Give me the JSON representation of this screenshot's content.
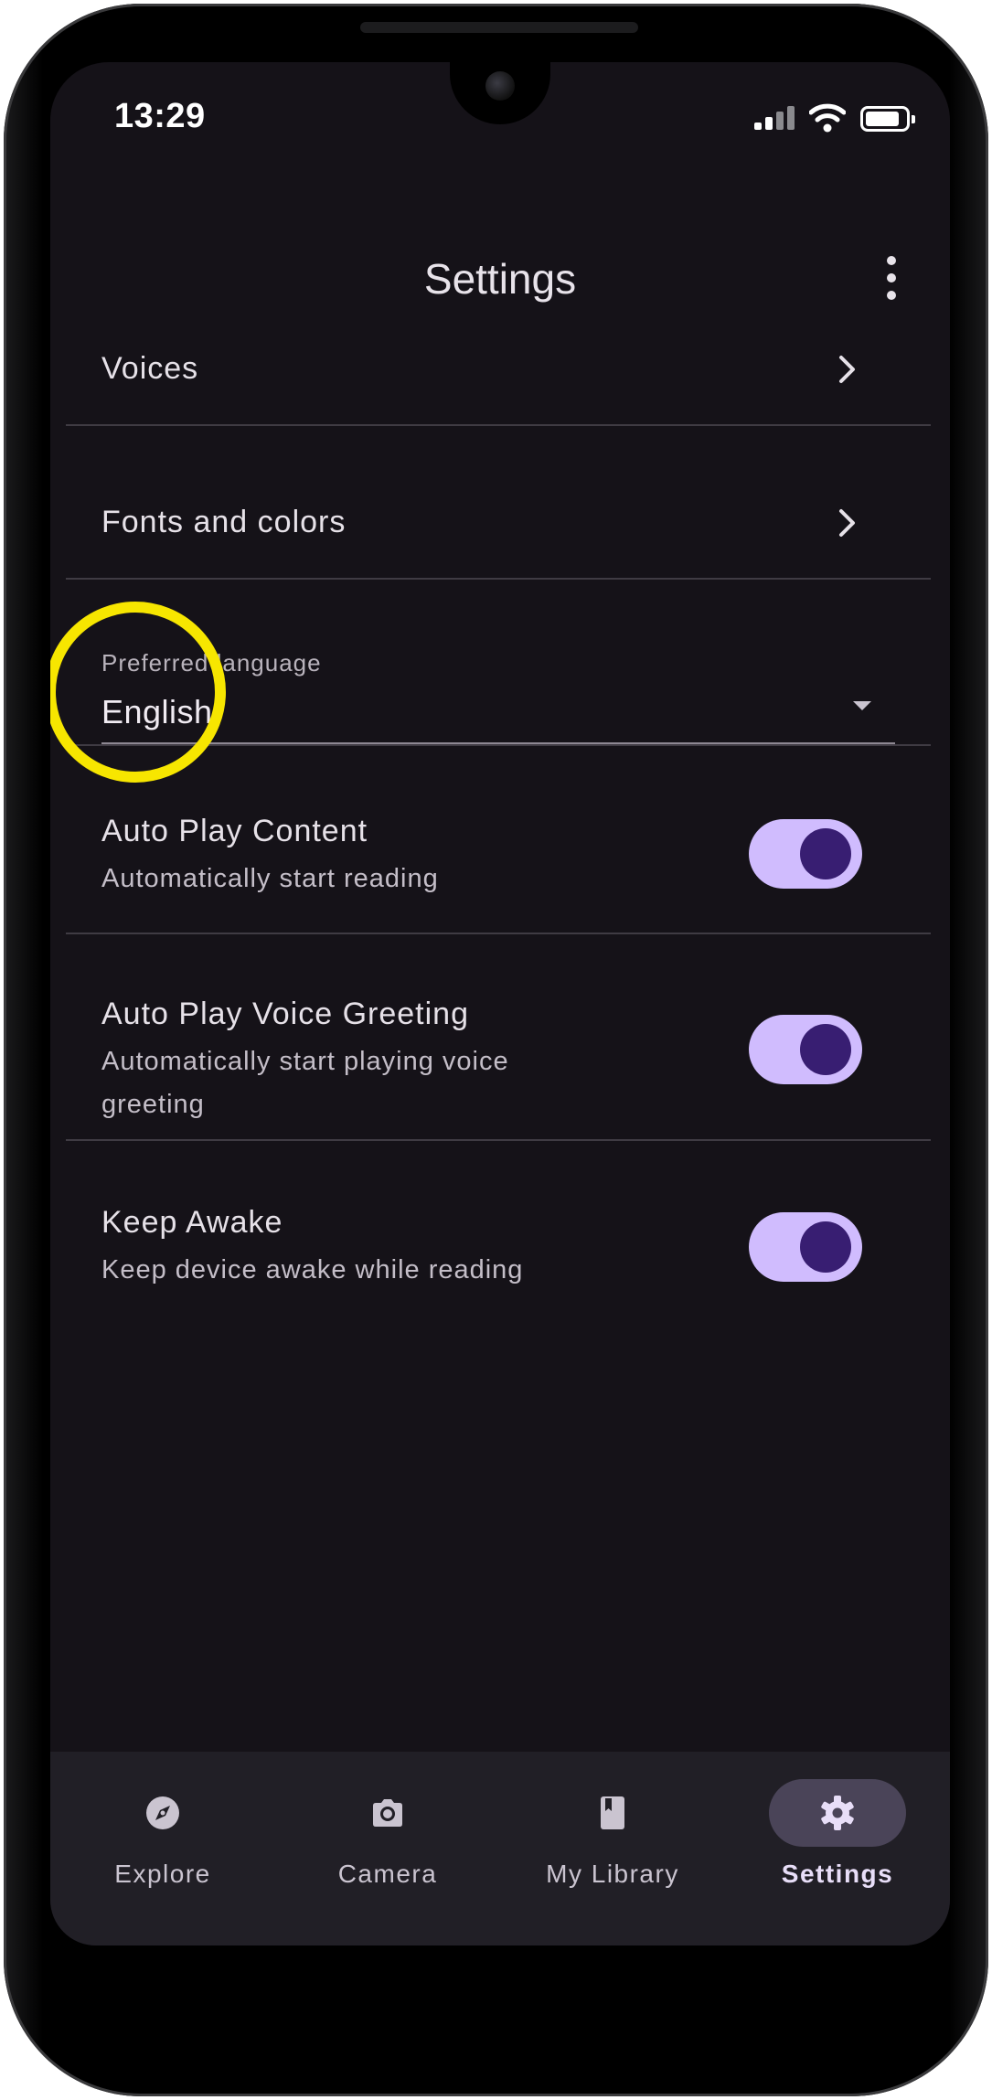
{
  "status_bar": {
    "time": "13:29"
  },
  "app_bar": {
    "title": "Settings",
    "menu_icon": "more-vert-icon"
  },
  "settings": {
    "nav_items": [
      {
        "label": "Voices",
        "icon": "chevron-right-icon"
      },
      {
        "label": "Fonts and colors",
        "icon": "chevron-right-icon"
      }
    ],
    "language": {
      "label": "Preferred language",
      "value": "English"
    },
    "toggles": [
      {
        "title": "Auto Play Content",
        "subtitle": "Automatically start reading",
        "on": true
      },
      {
        "title": "Auto Play Voice Greeting",
        "subtitle": "Automatically start playing voice greeting",
        "on": true
      },
      {
        "title": "Keep Awake",
        "subtitle": "Keep device awake while reading",
        "on": true
      }
    ]
  },
  "bottom_nav": {
    "tabs": [
      {
        "label": "Explore",
        "icon": "compass-icon"
      },
      {
        "label": "Camera",
        "icon": "camera-icon"
      },
      {
        "label": "My Library",
        "icon": "book-icon"
      },
      {
        "label": "Settings",
        "icon": "gear-icon",
        "active": true
      }
    ]
  },
  "colors": {
    "background": "#151218",
    "switch_track": "#d0bcfe",
    "switch_thumb": "#381e72",
    "active_indicator": "#4a4458",
    "annotation": "#f7e600"
  }
}
